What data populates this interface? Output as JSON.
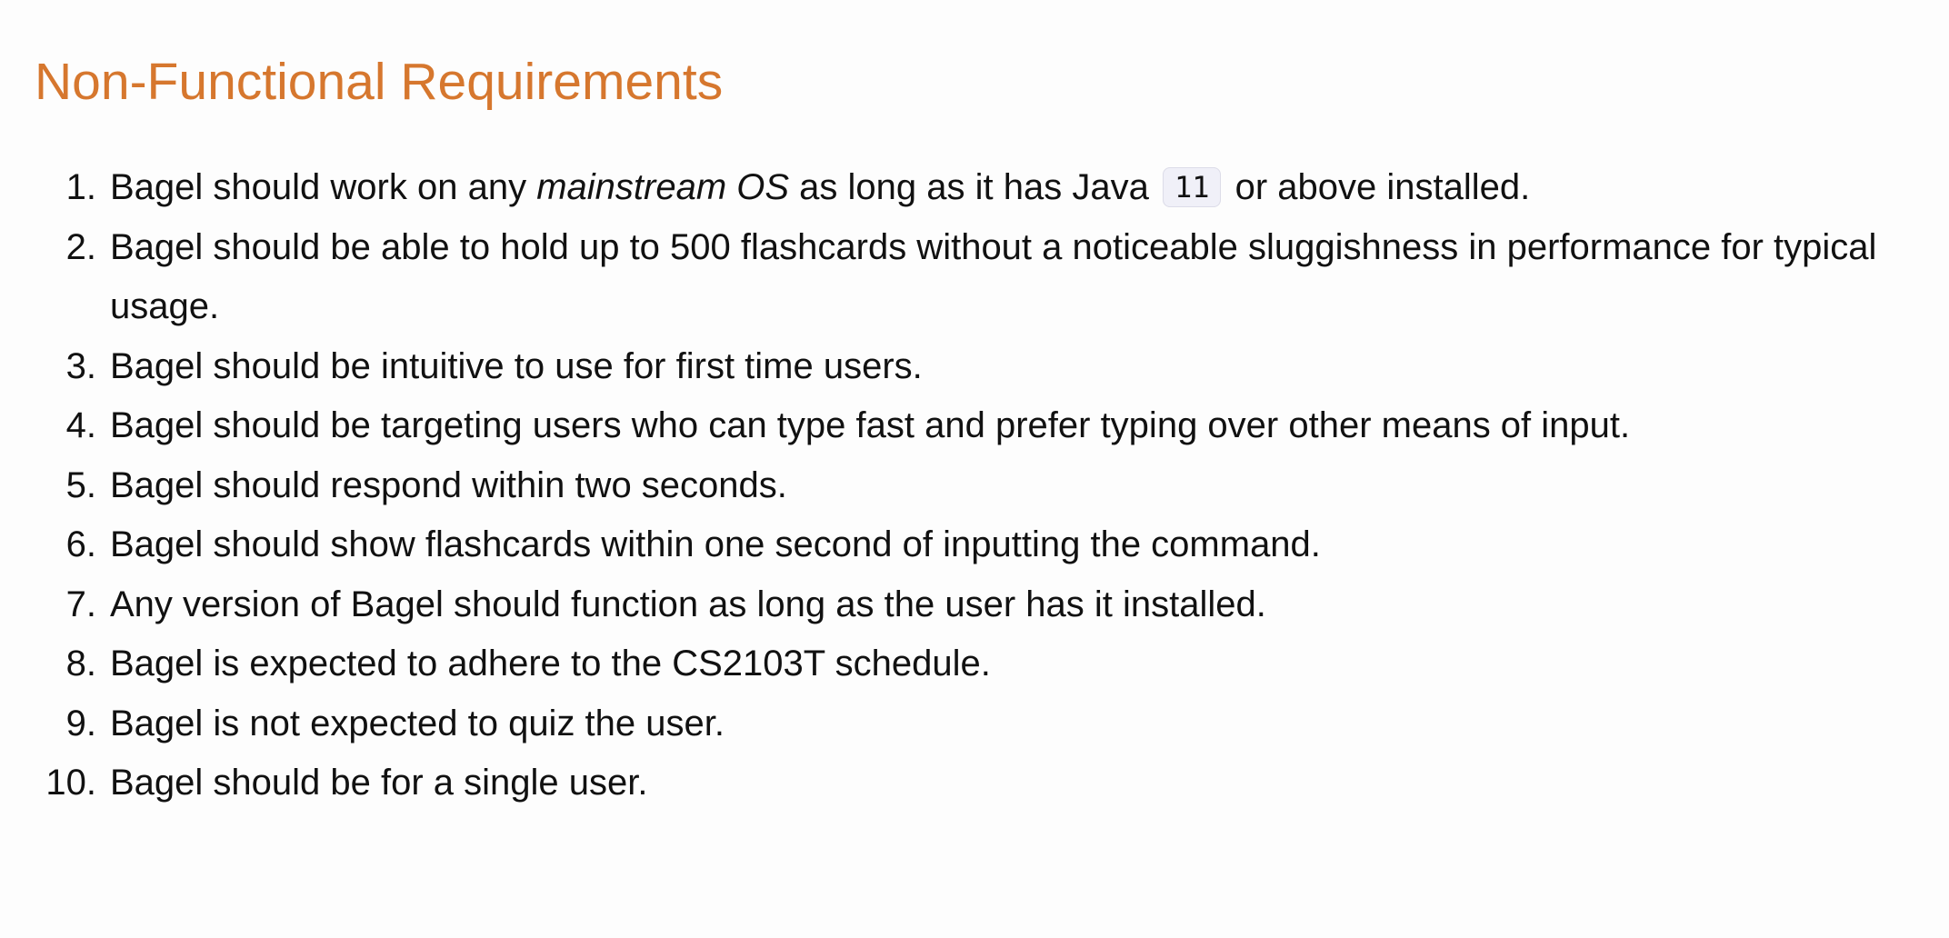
{
  "heading": "Non-Functional Requirements",
  "items": [
    {
      "number": "1.",
      "before": "Bagel should work on any ",
      "emphasis": "mainstream OS",
      "middle": " as long as it has Java ",
      "code": "11",
      "after": " or above installed."
    },
    {
      "number": "2.",
      "text": "Bagel should be able to hold up to 500 flashcards without a noticeable sluggishness in performance for typical usage."
    },
    {
      "number": "3.",
      "text": "Bagel should be intuitive to use for first time users."
    },
    {
      "number": "4.",
      "text": "Bagel should be targeting users who can type fast and prefer typing over other means of input."
    },
    {
      "number": "5.",
      "text": "Bagel should respond within two seconds."
    },
    {
      "number": "6.",
      "text": "Bagel should show flashcards within one second of inputting the command."
    },
    {
      "number": "7.",
      "text": "Any version of Bagel should function as long as the user has it installed."
    },
    {
      "number": "8.",
      "text": "Bagel is expected to adhere to the CS2103T schedule."
    },
    {
      "number": "9.",
      "text": "Bagel is not expected to quiz the user."
    },
    {
      "number": "10.",
      "text": "Bagel should be for a single user."
    }
  ],
  "colors": {
    "heading": "#d6772e",
    "text": "#111111",
    "background": "#fdfdfd",
    "code_background": "#f0f0f8"
  }
}
